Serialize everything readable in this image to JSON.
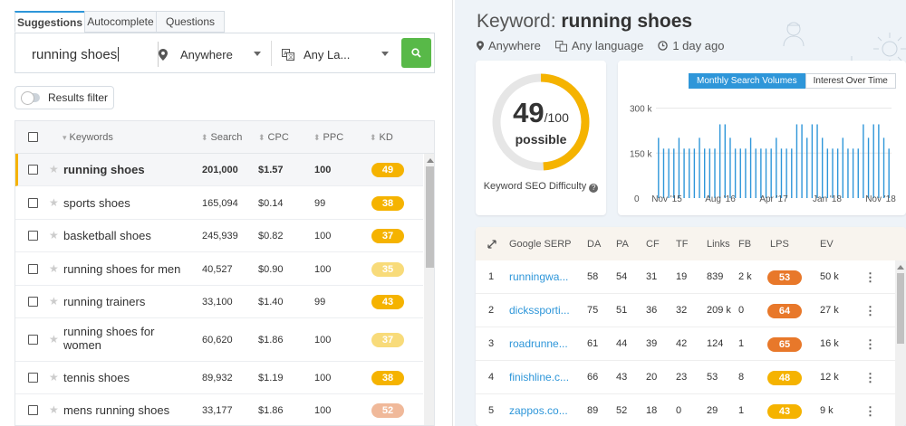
{
  "tabs": [
    {
      "label": "Suggestions",
      "active": true
    },
    {
      "label": "Autocomplete",
      "active": false
    },
    {
      "label": "Questions",
      "active": false
    }
  ],
  "search": {
    "value": "running shoes",
    "location": "Anywhere",
    "language": "Any La...",
    "search_icon": "search-icon"
  },
  "filter": {
    "label": "Results filter"
  },
  "table": {
    "headers": {
      "keywords": "Keywords",
      "search": "Search",
      "cpc": "CPC",
      "ppc": "PPC",
      "kd": "KD"
    },
    "rows": [
      {
        "keyword": "running shoes",
        "search": "201,000",
        "cpc": "$1.57",
        "ppc": "100",
        "kd": "49",
        "kd_color": "#f5b300",
        "highlighted": true
      },
      {
        "keyword": "sports shoes",
        "search": "165,094",
        "cpc": "$0.14",
        "ppc": "99",
        "kd": "38",
        "kd_color": "#f5b300"
      },
      {
        "keyword": "basketball shoes",
        "search": "245,939",
        "cpc": "$0.82",
        "ppc": "100",
        "kd": "37",
        "kd_color": "#f5b300"
      },
      {
        "keyword": "running shoes for men",
        "search": "40,527",
        "cpc": "$0.90",
        "ppc": "100",
        "kd": "35",
        "kd_color": "#f8db7a"
      },
      {
        "keyword": "running trainers",
        "search": "33,100",
        "cpc": "$1.40",
        "ppc": "99",
        "kd": "43",
        "kd_color": "#f5b300"
      },
      {
        "keyword": "running shoes for women",
        "search": "60,620",
        "cpc": "$1.86",
        "ppc": "100",
        "kd": "37",
        "kd_color": "#f8db7a"
      },
      {
        "keyword": "tennis shoes",
        "search": "89,932",
        "cpc": "$1.19",
        "ppc": "100",
        "kd": "38",
        "kd_color": "#f5b300"
      },
      {
        "keyword": "mens running shoes",
        "search": "33,177",
        "cpc": "$1.86",
        "ppc": "100",
        "kd": "52",
        "kd_color": "#f0b99a"
      }
    ]
  },
  "overview": {
    "title_prefix": "Keyword: ",
    "title_keyword": "running shoes",
    "location": "Anywhere",
    "language": "Any language",
    "updated": "1 day ago"
  },
  "difficulty": {
    "value": "49",
    "max": "/100",
    "label": "possible",
    "caption": "Keyword SEO Difficulty",
    "fraction": 0.49,
    "color": "#f5b300"
  },
  "volume_chart": {
    "buttons": [
      {
        "label": "Monthly Search Volumes",
        "active": true
      },
      {
        "label": "Interest Over Time",
        "active": false
      }
    ]
  },
  "chart_data": {
    "type": "bar",
    "title": "",
    "xlabel": "",
    "ylabel": "",
    "ylim": [
      0,
      350000
    ],
    "yticks": [
      "0",
      "150 k",
      "300 k"
    ],
    "xticks": [
      "Nov '15",
      "Aug '16",
      "Apr '17",
      "Jan '18",
      "Nov '18"
    ],
    "series": [
      {
        "color": "#2e96d9",
        "values": [
          201000,
          165000,
          165000,
          165000,
          201000,
          165000,
          165000,
          165000,
          201000,
          165000,
          165000,
          165000,
          246000,
          246000,
          201000,
          165000,
          165000,
          165000,
          201000,
          165000,
          165000,
          165000,
          165000,
          201000,
          165000,
          165000,
          165000,
          246000,
          246000,
          201000,
          246000,
          246000,
          201000,
          165000,
          165000,
          165000,
          201000,
          165000,
          165000,
          165000,
          246000,
          201000,
          246000,
          246000,
          201000,
          165000
        ]
      }
    ],
    "grid": true
  },
  "serp": {
    "headers": {
      "serp": "Google SERP",
      "da": "DA",
      "pa": "PA",
      "cf": "CF",
      "tf": "TF",
      "links": "Links",
      "fb": "FB",
      "lps": "LPS",
      "ev": "EV"
    },
    "rows": [
      {
        "rank": "1",
        "url": "runningwa...",
        "da": "58",
        "pa": "54",
        "cf": "31",
        "tf": "19",
        "links": "839",
        "fb": "2 k",
        "lps": "53",
        "lps_color": "#e8782a",
        "ev": "50 k"
      },
      {
        "rank": "2",
        "url": "dickssporti...",
        "da": "75",
        "pa": "51",
        "cf": "36",
        "tf": "32",
        "links": "209 k",
        "fb": "0",
        "lps": "64",
        "lps_color": "#e8782a",
        "ev": "27 k"
      },
      {
        "rank": "3",
        "url": "roadrunne...",
        "da": "61",
        "pa": "44",
        "cf": "39",
        "tf": "42",
        "links": "124",
        "fb": "1",
        "lps": "65",
        "lps_color": "#e8782a",
        "ev": "16 k"
      },
      {
        "rank": "4",
        "url": "finishline.c...",
        "da": "66",
        "pa": "43",
        "cf": "20",
        "tf": "23",
        "links": "53",
        "fb": "8",
        "lps": "48",
        "lps_color": "#f5b300",
        "ev": "12 k"
      },
      {
        "rank": "5",
        "url": "zappos.co...",
        "da": "89",
        "pa": "52",
        "cf": "18",
        "tf": "0",
        "links": "29",
        "fb": "1",
        "lps": "43",
        "lps_color": "#f5b300",
        "ev": "9 k"
      }
    ]
  }
}
